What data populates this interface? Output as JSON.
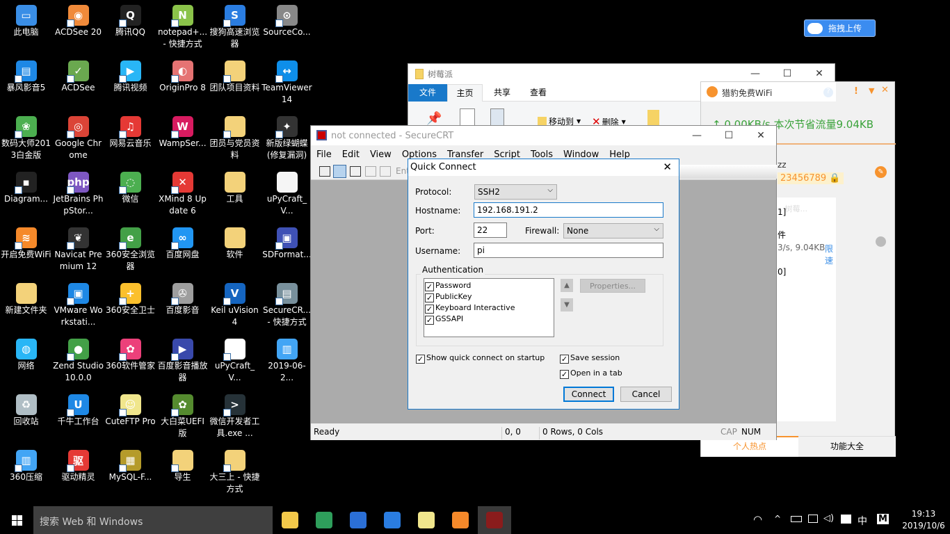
{
  "desktop_icons": [
    {
      "label": "此电脑",
      "color": "#3a8ee6",
      "glyph": "▭",
      "noarrow": true
    },
    {
      "label": "ACDSee 20",
      "color": "#f08a3a",
      "glyph": "◉"
    },
    {
      "label": "腾讯QQ",
      "color": "#222",
      "glyph": "Q"
    },
    {
      "label": "notepad+... - 快捷方式",
      "color": "#8bc34a",
      "glyph": "N"
    },
    {
      "label": "搜狗高速浏览器",
      "color": "#2a7de1",
      "glyph": "S"
    },
    {
      "label": "SourceCo...",
      "color": "#888",
      "glyph": "⊙"
    },
    {
      "label": "暴风影音5",
      "color": "#1e88e5",
      "glyph": "▤"
    },
    {
      "label": "ACDSee",
      "color": "#6aa84f",
      "glyph": "✓"
    },
    {
      "label": "腾讯视频",
      "color": "#29b6f6",
      "glyph": "▶"
    },
    {
      "label": "OriginPro 8",
      "color": "#e57373",
      "glyph": "◐"
    },
    {
      "label": "团队项目资料",
      "color": "#f3d27a",
      "glyph": ""
    },
    {
      "label": "TeamViewer 14",
      "color": "#0e8ee9",
      "glyph": "↔"
    },
    {
      "label": "数码大师2013白金版",
      "color": "#4caf50",
      "glyph": "❀"
    },
    {
      "label": "Google Chrome",
      "color": "#db4437",
      "glyph": "◎"
    },
    {
      "label": "网易云音乐",
      "color": "#e53935",
      "glyph": "♫"
    },
    {
      "label": "WampSer...",
      "color": "#d81b60",
      "glyph": "W"
    },
    {
      "label": "团员与党员资料",
      "color": "#f3d27a",
      "glyph": ""
    },
    {
      "label": "新版绿蝴蝶(修复漏洞)O...",
      "color": "#333",
      "glyph": "✦"
    },
    {
      "label": "Diagram...",
      "color": "#222",
      "glyph": "▪"
    },
    {
      "label": "JetBrains PhpStor...",
      "color": "#7e57c2",
      "glyph": "php"
    },
    {
      "label": "微信",
      "color": "#4caf50",
      "glyph": "◌"
    },
    {
      "label": "XMind 8 Update 6",
      "color": "#e53935",
      "glyph": "✕"
    },
    {
      "label": "工具",
      "color": "#f3d27a",
      "glyph": "",
      "noarrow": true
    },
    {
      "label": "uPyCraft_V...",
      "color": "#f5f5f5",
      "glyph": "",
      "noarrow": true
    },
    {
      "label": "开启免费WiFi",
      "color": "#f5892a",
      "glyph": "≋"
    },
    {
      "label": "Navicat Premium 12",
      "color": "#333",
      "glyph": "❦"
    },
    {
      "label": "360安全浏览器",
      "color": "#43a047",
      "glyph": "e"
    },
    {
      "label": "百度网盘",
      "color": "#2196f3",
      "glyph": "∞"
    },
    {
      "label": "软件",
      "color": "#f3d27a",
      "glyph": "",
      "noarrow": true
    },
    {
      "label": "SDFormat...",
      "color": "#3f51b5",
      "glyph": "▣"
    },
    {
      "label": "新建文件夹",
      "color": "#f3d27a",
      "glyph": "",
      "noarrow": true
    },
    {
      "label": "VMware Workstati...",
      "color": "#1e88e5",
      "glyph": "▣"
    },
    {
      "label": "360安全卫士",
      "color": "#fbc02d",
      "glyph": "+"
    },
    {
      "label": "百度影音",
      "color": "#9e9e9e",
      "glyph": "✇"
    },
    {
      "label": "Keil uVision4",
      "color": "#1565c0",
      "glyph": "V"
    },
    {
      "label": "SecureCR... - 快捷方式",
      "color": "#78909c",
      "glyph": "▤"
    },
    {
      "label": "网络",
      "color": "#29b6f6",
      "glyph": "◍",
      "noarrow": true
    },
    {
      "label": "Zend Studio 10.0.0",
      "color": "#43a047",
      "glyph": "●"
    },
    {
      "label": "360软件管家",
      "color": "#ec407a",
      "glyph": "✿"
    },
    {
      "label": "百度影音播放器",
      "color": "#3949ab",
      "glyph": "▶"
    },
    {
      "label": "uPyCraft_V...",
      "color": "#fff",
      "glyph": "ɗ"
    },
    {
      "label": "2019-06-2...",
      "color": "#42a5f5",
      "glyph": "▥",
      "noarrow": true
    },
    {
      "label": "回收站",
      "color": "#b0bec5",
      "glyph": "♻",
      "noarrow": true
    },
    {
      "label": "千牛工作台",
      "color": "#1e88e5",
      "glyph": "U"
    },
    {
      "label": "CuteFTP Pro",
      "color": "#f0e68c",
      "glyph": "☺"
    },
    {
      "label": "大白菜UEFI版",
      "color": "#558b2f",
      "glyph": "✿"
    },
    {
      "label": "微信开发者工具.exe ...",
      "color": "#263238",
      "glyph": ">"
    },
    {
      "label": "",
      "color": "",
      "glyph": ""
    },
    {
      "label": "360压缩",
      "color": "#42a5f5",
      "glyph": "▥"
    },
    {
      "label": "驱动精灵",
      "color": "#e53935",
      "glyph": "驱"
    },
    {
      "label": "MySQL-F...",
      "color": "#b59b2a",
      "glyph": "▦"
    },
    {
      "label": "导生",
      "color": "#f3d27a",
      "glyph": ""
    },
    {
      "label": "大三上 - 快捷方式",
      "color": "#f3d27a",
      "glyph": ""
    }
  ],
  "baidu_upload": {
    "label": "拖拽上传"
  },
  "explorer": {
    "title": "树莓派",
    "tabs": [
      "文件",
      "主页",
      "共享",
      "查看"
    ],
    "move_to": "移动到",
    "delete": "删除"
  },
  "wifi": {
    "title": "猎豹免费WiFi",
    "speed": "↑ 0.00KB/s  本次节省流量9.04KB",
    "ssid_frag": "zz",
    "password_frag": "23456789",
    "search_frag": "...树莓...",
    "list_frag_1": "1]",
    "list_frag_2": "件",
    "list_frag_3": "3/s, 9.04KB",
    "limit": "限速",
    "list_frag_4": "0]",
    "tabs": [
      "个人热点",
      "功能大全"
    ],
    "accent": "#f7932e"
  },
  "securecrt": {
    "title": "not connected - SecureCRT",
    "menu": [
      "File",
      "Edit",
      "View",
      "Options",
      "Transfer",
      "Script",
      "Tools",
      "Window",
      "Help"
    ],
    "toolbar_input": "Ent",
    "status": {
      "ready": "Ready",
      "pos": "0, 0",
      "size": "0 Rows, 0 Cols",
      "cap": "CAP",
      "num": "NUM"
    }
  },
  "quick_connect": {
    "title": "Quick Connect",
    "protocol_label": "Protocol:",
    "protocol": "SSH2",
    "hostname_label": "Hostname:",
    "hostname": "192.168.191.2",
    "port_label": "Port:",
    "port": "22",
    "firewall_label": "Firewall:",
    "firewall": "None",
    "username_label": "Username:",
    "username": "pi",
    "auth_label": "Authentication",
    "auth_methods": [
      {
        "label": "Password",
        "checked": true
      },
      {
        "label": "PublicKey",
        "checked": true
      },
      {
        "label": "Keyboard Interactive",
        "checked": true
      },
      {
        "label": "GSSAPI",
        "checked": true
      }
    ],
    "properties": "Properties...",
    "show_on_startup": {
      "label": "Show quick connect on startup",
      "checked": true
    },
    "save_session": {
      "label": "Save session",
      "checked": true
    },
    "open_in_tab": {
      "label": "Open in a tab",
      "checked": true
    },
    "connect": "Connect",
    "cancel": "Cancel"
  },
  "taskbar": {
    "search_placeholder": "搜索 Web 和 Windows",
    "time": "19:13",
    "date": "2019/10/6",
    "ime": "中",
    "ime2": "M",
    "pinned": [
      {
        "name": "file-explorer",
        "color": "#f3c94a"
      },
      {
        "name": "app-green",
        "color": "#2e9e5b"
      },
      {
        "name": "wps",
        "color": "#2b6fd6"
      },
      {
        "name": "sogou-browser",
        "color": "#2a7de1"
      },
      {
        "name": "cuteftp",
        "color": "#f0e68c"
      },
      {
        "name": "cheetah-wifi",
        "color": "#f5892a"
      },
      {
        "name": "securecrt",
        "color": "#8a1c1c"
      }
    ]
  }
}
